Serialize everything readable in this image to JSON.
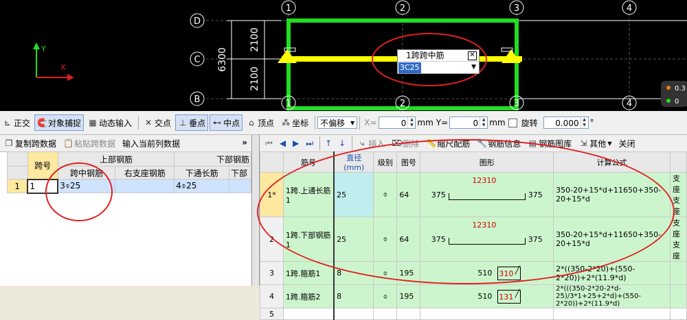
{
  "cad": {
    "axis_top": [
      "1",
      "2",
      "3",
      "4"
    ],
    "axis_bottom": [
      "1",
      "2",
      "3",
      "4"
    ],
    "axis_left": [
      "D",
      "C",
      "B"
    ],
    "dim_vertical": [
      "2100",
      "2100"
    ],
    "dim_total": "6300",
    "ucs_y": "Y",
    "ucs_x": "X",
    "popup_title": "1跨跨中筋",
    "popup_value": "3C25",
    "popup_close": "✕",
    "right_indicator_top": "0.3",
    "right_indicator_bottom": "0"
  },
  "toolbar": {
    "ortho": "正交",
    "snap": "对象捕捉",
    "dynamic_input": "动态输入",
    "intersection": "交点",
    "perpendicular": "垂点",
    "midpoint": "中点",
    "vertex": "顶点",
    "coordinate": "坐标",
    "offset_select": "不偏移",
    "x_label": "X=",
    "x_value": "0",
    "mm1": "mm",
    "y_label": "Y=",
    "y_value": "0",
    "mm2": "mm",
    "rotate": "旋转",
    "rotate_value": "0.000",
    "deg": "°"
  },
  "left_panel": {
    "copy_span": "复制跨数据",
    "paste_span": "粘贴跨数据",
    "input_col": "输入当前列数据",
    "collapse": "»",
    "header_span_no": "跨号",
    "header_top_rebar": "上部钢筋",
    "header_bottom_rebar": "下部钢筋",
    "col_mid_rebar": "跨中钢筋",
    "col_right_support": "右支座钢筋",
    "col_bottom_through": "下通长筋",
    "col_bottom_more": "下部",
    "row": {
      "index": "1",
      "span": "1",
      "mid_rebar": "3⌽25",
      "right_support": "",
      "bottom_through": "4⌽25",
      "bottom_more": ""
    }
  },
  "right_panel": {
    "toolbar": {
      "first": "⏮",
      "prev": "◀",
      "next": "▶",
      "last": "⏭",
      "up": "↑",
      "down": "↓",
      "insert": "插入",
      "delete": "删除",
      "scale_match": "缩尺配筋",
      "rebar_info": "钢筋信息",
      "rebar_library": "钢筋图库",
      "other": "其他",
      "close": "关闭"
    },
    "headers": {
      "name": "筋号",
      "diameter": "直径(mm)",
      "grade": "级别",
      "figure_no": "图号",
      "shape": "图形",
      "formula": "计算公式",
      "more": ""
    },
    "rows": [
      {
        "index": "1*",
        "name": "1跨.上通长筋1",
        "diameter": "25",
        "grade": "⌽",
        "figure_no": "64",
        "shape_left": "375",
        "shape_mid": "12310",
        "shape_right": "375",
        "shape_type": "u-top",
        "formula": "350-20+15*d+11650+350-20+15*d",
        "more": "支座 支座"
      },
      {
        "index": "2",
        "name": "1跨.下部钢筋1",
        "diameter": "25",
        "grade": "⌽",
        "figure_no": "64",
        "shape_left": "375",
        "shape_mid": "12310",
        "shape_right": "375",
        "shape_type": "u-top",
        "formula": "350-20+15*d+11650+350-20+15*d",
        "more": "支座 支座"
      },
      {
        "index": "3",
        "name": "1跨.箍筋1",
        "diameter": "8",
        "grade": "⌽",
        "figure_no": "195",
        "shape_left": "510",
        "shape_mid": "310",
        "shape_right": "",
        "shape_type": "stirrup",
        "formula": "2*((350-2*20)+(550-2*20))+2*(11.9*d)",
        "more": ""
      },
      {
        "index": "4",
        "name": "1跨.箍筋2",
        "diameter": "8",
        "grade": "⌽",
        "figure_no": "195",
        "shape_left": "510",
        "shape_mid": "131",
        "shape_right": "",
        "shape_type": "stirrup",
        "formula": "2*(((350-2*20-2*d-25)/3*1+25+2*d)+(550-2*20))+2*(11.9*d)",
        "more": ""
      }
    ],
    "empty_row_index": "5"
  },
  "colors": {
    "cad_bg": "#000000",
    "beam_green": "#22dd22",
    "beam_yellow": "#ffff00",
    "annotation_red": "#e02020",
    "row_green": "#cdf5cd"
  }
}
